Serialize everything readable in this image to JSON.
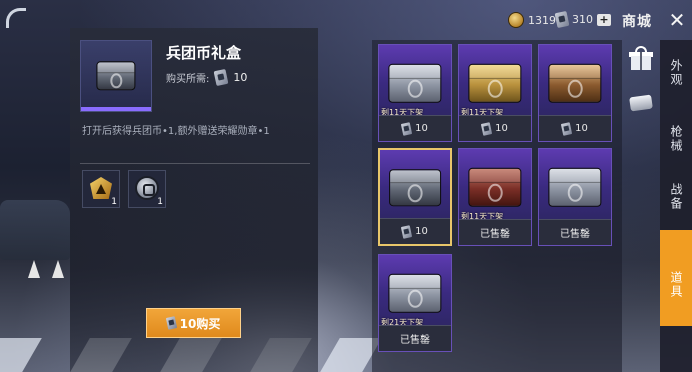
{
  "topbar": {
    "coins": "1319",
    "tickets": "310",
    "plus_label": "+",
    "shop_title": "商城",
    "close_label": "✕"
  },
  "detail": {
    "name": "兵团币礼盒",
    "price_label": "购买所需:",
    "price_value": "10",
    "description": "打开后获得兵团币•1,额外赠送荣耀勋章•1",
    "rewards": [
      {
        "icon": "honor-medal-icon",
        "count": "1"
      },
      {
        "icon": "legion-coin-icon",
        "count": "1"
      }
    ],
    "buy_button": "10购买"
  },
  "items": [
    {
      "tag": "剩11天下架",
      "price": "10",
      "sold": "",
      "box": "silver"
    },
    {
      "tag": "剩11天下架",
      "price": "10",
      "sold": "",
      "box": "gold"
    },
    {
      "tag": "",
      "price": "10",
      "sold": "",
      "box": "brown"
    },
    {
      "tag": "",
      "price": "10",
      "sold": "",
      "box": "graphite"
    },
    {
      "tag": "剩11天下架",
      "price": "",
      "sold": "已售罄",
      "box": "red"
    },
    {
      "tag": "",
      "price": "",
      "sold": "已售罄",
      "box": "silver"
    },
    {
      "tag": "剩21天下架",
      "price": "",
      "sold": "已售罄",
      "box": "silver"
    }
  ],
  "tabs": [
    {
      "label": "外观",
      "active": false
    },
    {
      "label": "枪械",
      "active": false
    },
    {
      "label": "战备",
      "active": false
    },
    {
      "label": "道具",
      "active": true
    }
  ],
  "colors": {
    "accent": "#f19d22",
    "card_purple": "#5d3bb0",
    "selected_border": "#e8c66a"
  }
}
